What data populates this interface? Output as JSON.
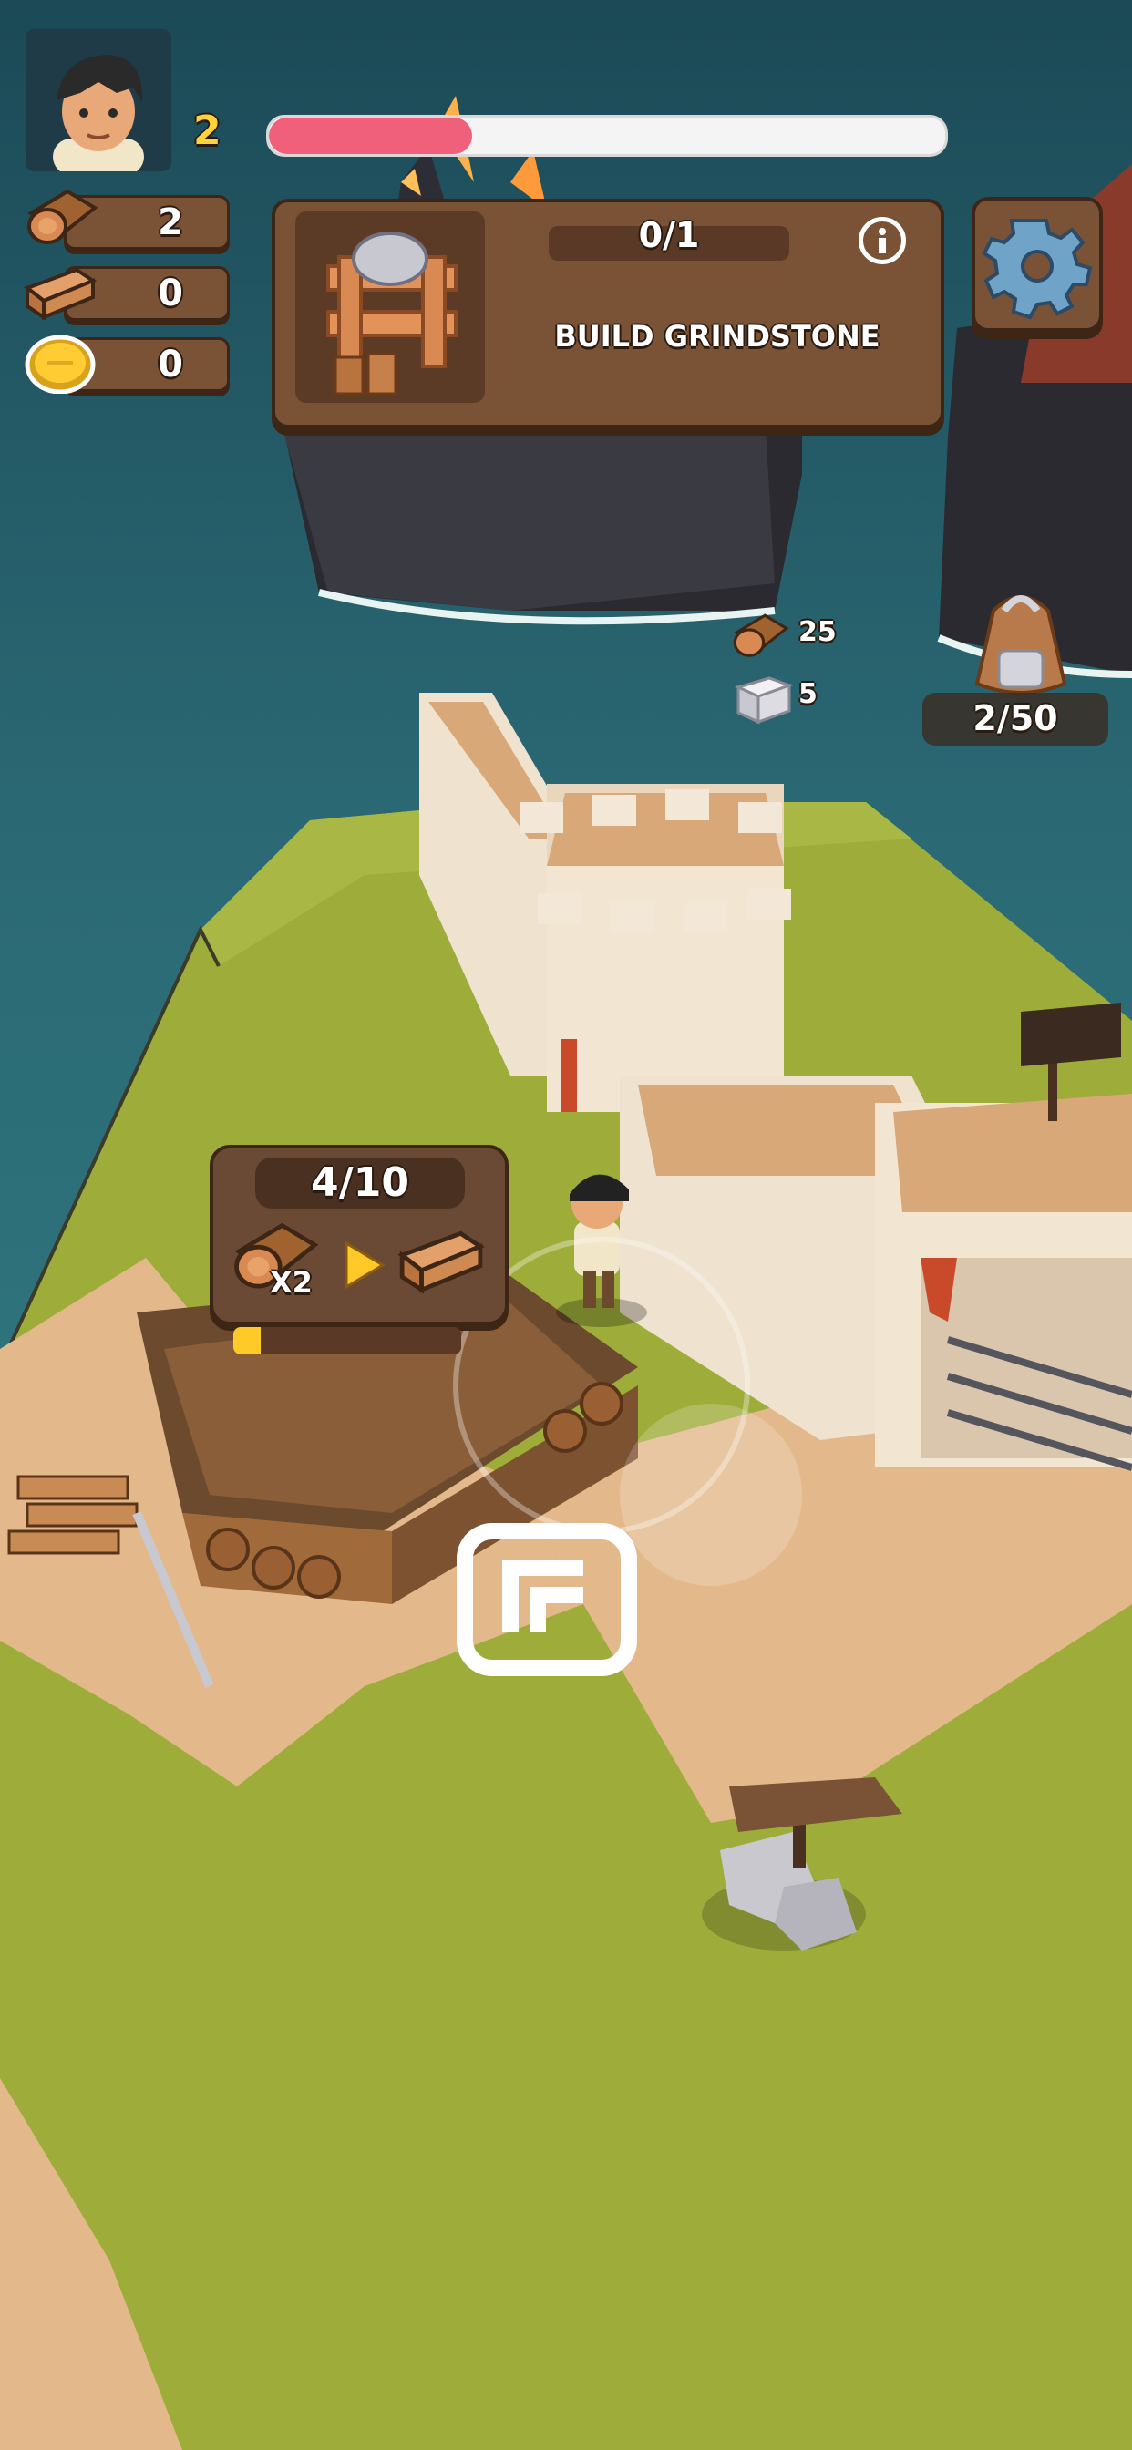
{
  "player": {
    "level": "2",
    "xp_progress": 0.3
  },
  "resources": [
    {
      "icon": "log-icon",
      "value": "2"
    },
    {
      "icon": "plank-icon",
      "value": "0"
    },
    {
      "icon": "coin-icon",
      "value": "0"
    }
  ],
  "quest": {
    "progress_text": "0/1",
    "progress": 0.0,
    "title": "BUILD GRINDSTONE",
    "icon": "grindstone-icon"
  },
  "build_cost": [
    {
      "icon": "log-icon",
      "value": "25"
    },
    {
      "icon": "stone-block-icon",
      "value": "5"
    }
  ],
  "backpack": {
    "capacity_text": "2/50"
  },
  "sawmill": {
    "queue_text": "4/10",
    "input_multiplier": "X2",
    "progress": 0.12
  },
  "colors": {
    "xp_fill": "#f0607a",
    "panel": "#7a5236",
    "grass": "#9ead3a",
    "sand": "#e3b98c",
    "sea": "#2e6f79"
  }
}
